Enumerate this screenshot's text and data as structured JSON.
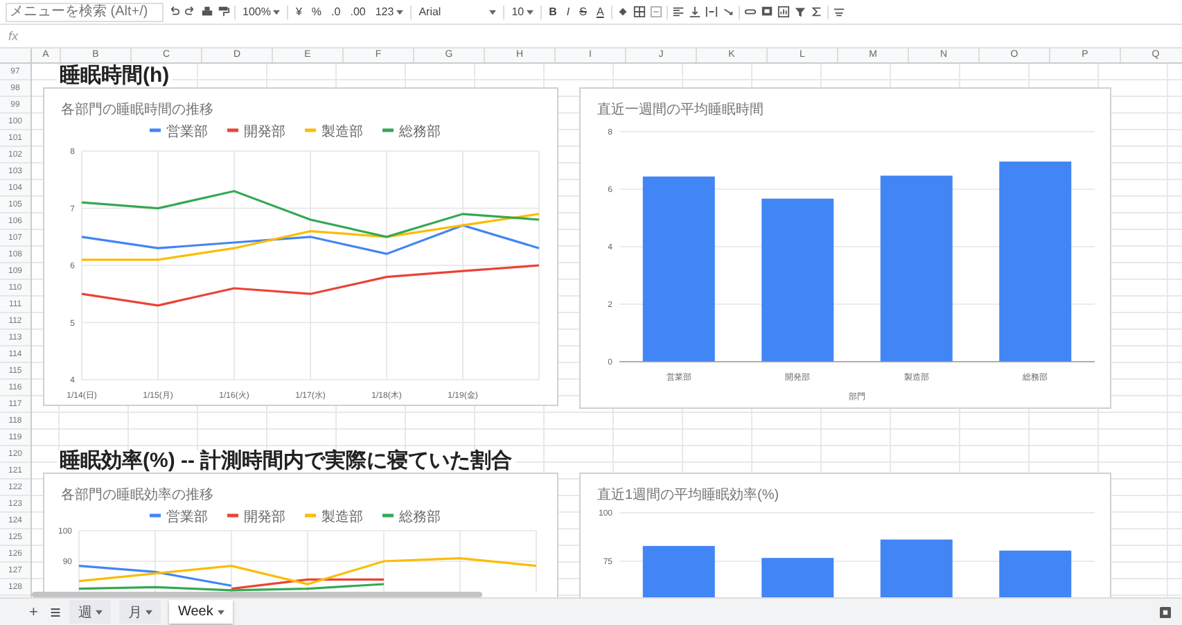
{
  "toolbar": {
    "menu_search": {
      "placeholder": "メニューを検索 (Alt+/)"
    },
    "zoom": "100%",
    "currency": "¥",
    "percent": "%",
    "decimal_decrease": ".0",
    "decimal_increase": ".00",
    "number_format": "123",
    "font": "Arial",
    "font_size": "10",
    "bold": "B",
    "italic": "I",
    "strikethrough": "S",
    "text_color": "A"
  },
  "formula_bar": {
    "label": "fx"
  },
  "columns": [
    "A",
    "B",
    "C",
    "D",
    "E",
    "F",
    "G",
    "H",
    "I",
    "J",
    "K",
    "L",
    "M",
    "N",
    "O",
    "P",
    "Q"
  ],
  "rows": [
    "97",
    "98",
    "99",
    "100",
    "101",
    "102",
    "103",
    "104",
    "105",
    "106",
    "107",
    "108",
    "109",
    "110",
    "111",
    "112",
    "113",
    "114",
    "115",
    "116",
    "117",
    "118",
    "119",
    "120",
    "121",
    "122",
    "123",
    "124",
    "125",
    "126",
    "127",
    "128"
  ],
  "sections": [
    {
      "heading": "睡眠時間(h)",
      "charts": [
        {
          "chart_data": {
            "type": "line",
            "title": "各部門の睡眠時間の推移",
            "categories": [
              "1/14(日)",
              "1/15(月)",
              "1/16(火)",
              "1/17(水)",
              "1/18(木)",
              "1/19(金)",
              null
            ],
            "ylim": [
              4,
              8
            ],
            "yticks": [
              4,
              5,
              6,
              7,
              8
            ],
            "grid": true,
            "legend": "top",
            "series": [
              {
                "name": "営業部",
                "color": "#4285f4",
                "values": [
                  6.5,
                  6.3,
                  6.4,
                  6.5,
                  6.2,
                  6.7,
                  6.3
                ]
              },
              {
                "name": "開発部",
                "color": "#ea4335",
                "values": [
                  5.5,
                  5.3,
                  5.6,
                  5.5,
                  5.8,
                  5.9,
                  6.0
                ]
              },
              {
                "name": "製造部",
                "color": "#fbbc04",
                "values": [
                  6.1,
                  6.1,
                  6.3,
                  6.6,
                  6.5,
                  6.7,
                  6.9
                ]
              },
              {
                "name": "総務部",
                "color": "#34a853",
                "values": [
                  7.1,
                  7.0,
                  7.3,
                  6.8,
                  6.5,
                  6.9,
                  6.8
                ]
              }
            ]
          }
        },
        {
          "chart_data": {
            "type": "bar",
            "title": "直近一週間の平均睡眠時間",
            "xlabel": "部門",
            "categories": [
              "営業部",
              "開発部",
              "製造部",
              "総務部"
            ],
            "ylim": [
              0,
              8
            ],
            "yticks": [
              0,
              2,
              4,
              6,
              8
            ],
            "grid": true,
            "series": [
              {
                "color": "#4285f4",
                "values": [
                  6.44,
                  5.67,
                  6.47,
                  6.96
                ]
              }
            ]
          }
        }
      ]
    },
    {
      "heading": "睡眠効率(%)  -- 計測時間内で実際に寝ていた割合",
      "charts": [
        {
          "chart_data": {
            "type": "line",
            "title": "各部門の睡眠効率の推移",
            "categories": [
              null,
              null,
              null,
              null,
              null,
              null,
              null
            ],
            "ylim": [
              80,
              100
            ],
            "yticks": [
              90,
              100
            ],
            "grid": true,
            "legend": "top",
            "series": [
              {
                "name": "営業部",
                "color": "#4285f4",
                "values": [
                  88.5,
                  86.5,
                  82,
                  null,
                  null,
                  null,
                  null
                ]
              },
              {
                "name": "開発部",
                "color": "#ea4335",
                "values": [
                  null,
                  null,
                  81,
                  84,
                  84,
                  null,
                  null
                ]
              },
              {
                "name": "製造部",
                "color": "#fbbc04",
                "values": [
                  83.5,
                  86,
                  88.5,
                  82.5,
                  90,
                  91,
                  88.5
                ]
              },
              {
                "name": "総務部",
                "color": "#34a853",
                "values": [
                  81,
                  81.5,
                  80.5,
                  81,
                  82.5,
                  null,
                  null
                ]
              }
            ]
          }
        },
        {
          "chart_data": {
            "type": "bar",
            "title": "直近1週間の平均睡眠効率(%)",
            "ylim": [
              0,
              100
            ],
            "yticks": [
              75,
              100
            ],
            "grid": true,
            "series": [
              {
                "color": "#4285f4",
                "values": [
                  82.9,
                  76.7,
                  86.2,
                  80.5
                ]
              }
            ]
          }
        }
      ]
    }
  ],
  "add_sheet": "+",
  "sheet_tabs": [
    {
      "label": "週",
      "selected": false
    },
    {
      "label": "月",
      "selected": false
    },
    {
      "label": "Week",
      "selected": true
    }
  ]
}
